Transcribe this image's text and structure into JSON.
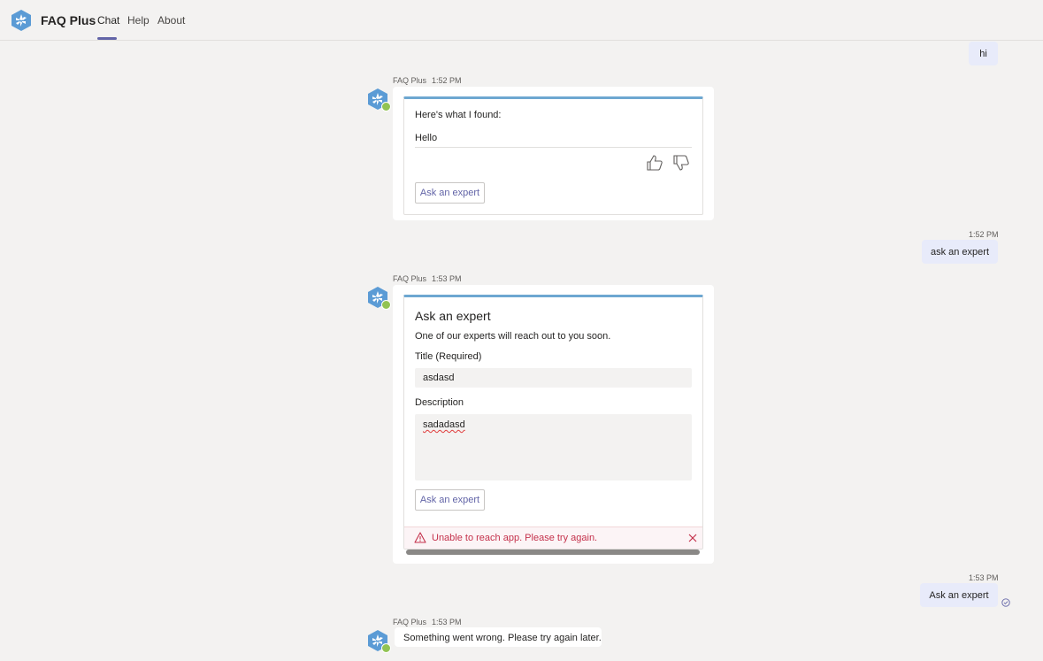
{
  "app": {
    "name": "FAQ Plus"
  },
  "tabs": [
    {
      "label": "Chat",
      "active": true
    },
    {
      "label": "Help",
      "active": false
    },
    {
      "label": "About",
      "active": false
    }
  ],
  "messages": {
    "m1": {
      "text": "hi"
    },
    "m2": {
      "sender": "FAQ Plus",
      "time": "1:52 PM",
      "card": {
        "heading": "Here's what I found:",
        "answer": "Hello",
        "button": "Ask an expert"
      }
    },
    "m3": {
      "time": "1:52 PM",
      "text": "ask an expert"
    },
    "m4": {
      "sender": "FAQ Plus",
      "time": "1:53 PM",
      "card": {
        "title": "Ask an expert",
        "subtitle": "One of our experts will reach out to you soon.",
        "title_label": "Title (Required)",
        "title_value": "asdasd",
        "description_label": "Description",
        "description_value": "sadadasd",
        "button": "Ask an expert",
        "error": "Unable to reach app. Please try again."
      }
    },
    "m5": {
      "time": "1:53 PM",
      "text": "Ask an expert"
    },
    "m6": {
      "sender": "FAQ Plus",
      "time": "1:53 PM",
      "text": "Something went wrong. Please try again later."
    }
  },
  "colors": {
    "accent": "#6264a7",
    "card_border_top": "#6da7d1",
    "error": "#c4314b",
    "outgoing_bubble": "#e8ebfa"
  },
  "icons": [
    "app-logo-icon",
    "thumbs-up-icon",
    "thumbs-down-icon",
    "warning-icon",
    "close-icon",
    "read-receipt-icon",
    "presence-available-icon"
  ]
}
